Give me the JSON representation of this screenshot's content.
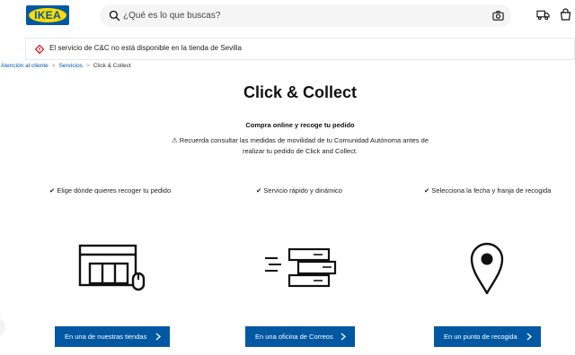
{
  "header": {
    "logo_text": "IKEA",
    "search": {
      "placeholder": "¿Qué es lo que buscas?",
      "icon": "search-icon",
      "camera_icon": "camera-icon"
    },
    "icons": [
      "truck-icon",
      "shopping-bag-icon"
    ]
  },
  "alert": {
    "icon": "warning-diamond-icon",
    "text": "El servicio de C&C no está disponible en la tienda de Sevilla",
    "color": "#cc0008"
  },
  "breadcrumb": {
    "items": [
      "Atención al cliente",
      "Servicios"
    ],
    "separator": ">",
    "current": "Click & Collect"
  },
  "main": {
    "title": "Click & Collect",
    "subtitle": "Compra online y recoge tu pedido",
    "notice": "⚠ Recuerda consultar las medidas de movilidad de tu Comunidad Autónoma antes de realizar tu pedido de Click and Collect.",
    "features": [
      "✔ Elige dónde quieres recoger tu pedido",
      "✔ Servicio rápido y dinámico",
      "✔ Selecciona la fecha y franja de recogida"
    ],
    "illustrations": [
      "store-with-mouse-icon",
      "fast-boxes-icon",
      "location-pin-icon"
    ],
    "buttons": [
      {
        "label": "En una de nuestras tiendas",
        "icon": "chevron-right-icon"
      },
      {
        "label": "En una oficina de Correos",
        "icon": "chevron-right-icon"
      },
      {
        "label": "En un punto de recogida",
        "icon": "chevron-right-icon"
      }
    ]
  },
  "colors": {
    "brand_blue": "#0058a3",
    "brand_yellow": "#ffdb00",
    "link": "#0058a3",
    "search_bg": "#f5f5f5"
  }
}
